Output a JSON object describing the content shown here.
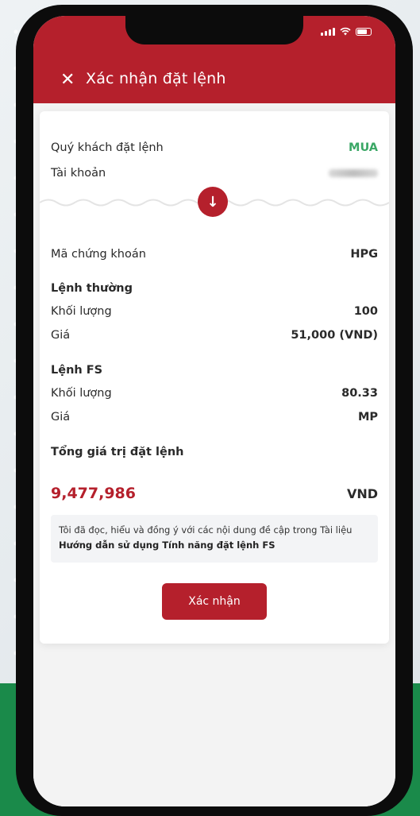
{
  "header": {
    "title": "Xác nhận đặt lệnh",
    "close_icon": "close-icon"
  },
  "account": {
    "customer_label": "Quý khách đặt lệnh",
    "customer_value": "MUA",
    "account_label": "Tài khoản"
  },
  "order": {
    "symbol_label": "Mã chứng khoán",
    "symbol_value": "HPG",
    "normal_title": "Lệnh thường",
    "normal_qty_label": "Khối lượng",
    "normal_qty_value": "100",
    "normal_price_label": "Giá",
    "normal_price_value": "51,000 (VND)",
    "fs_title": "Lệnh FS",
    "fs_qty_label": "Khối lượng",
    "fs_qty_value": "80.33",
    "fs_price_label": "Giá",
    "fs_price_value": "MP",
    "total_label": "Tổng giá trị đặt lệnh",
    "total_value": "9,477,986",
    "total_unit": "VND"
  },
  "notice": {
    "text": "Tôi đã đọc, hiểu và đồng ý với các nội dung đề cập trong Tài liệu",
    "link": "Hướng dẫn sử dụng Tính năng đặt lệnh FS"
  },
  "confirm_label": "Xác nhận",
  "colors": {
    "brand": "#b5202c",
    "buy": "#3aa765",
    "phone": "#0c0c0c",
    "green_bg": "#1a8a4a"
  }
}
